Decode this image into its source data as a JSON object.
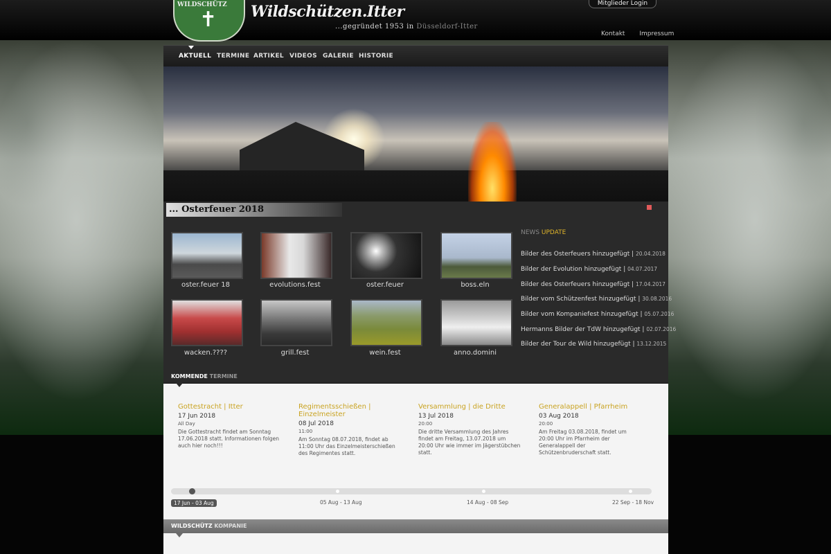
{
  "header": {
    "site_title": "Wildschützen.Itter",
    "subtitle_pre": "...gegründet 1953 in ",
    "subtitle_place": "Düsseldorf-Itter",
    "logo_text": "WILDSCHÜTZ",
    "login_label": "Mitglieder Login",
    "links": [
      "Kontakt",
      "Impressum"
    ]
  },
  "nav": {
    "items": [
      "AKTUELL",
      "TERMINE",
      "ARTIKEL",
      "VIDEOS",
      "GALERIE",
      "HISTORIE"
    ],
    "active": "AKTUELL"
  },
  "hero": {
    "caption": "... Osterfeuer 2018",
    "accent": "#e25a5a"
  },
  "gallery": {
    "items": [
      {
        "label": "oster.feuer 18"
      },
      {
        "label": "evolutions.fest"
      },
      {
        "label": "oster.feuer"
      },
      {
        "label": "boss.eln"
      },
      {
        "label": "wacken.????"
      },
      {
        "label": "grill.fest"
      },
      {
        "label": "wein.fest"
      },
      {
        "label": "anno.domini"
      }
    ]
  },
  "news": {
    "head_pre": "NEWS ",
    "head_hl": "UPDATE",
    "items": [
      {
        "text": "Bilder des Osterfeuers hinzugefügt",
        "date": "20.04.2018"
      },
      {
        "text": "Bilder der Evolution hinzugefügt",
        "date": "04.07.2017"
      },
      {
        "text": "Bilder des Osterfeuers hinzugefügt",
        "date": "17.04.2017"
      },
      {
        "text": "Bilder vom Schützenfest hinzugefügt",
        "date": "30.08.2016"
      },
      {
        "text": "Bilder vom Kompaniefest hinzugefügt",
        "date": "05.07.2016"
      },
      {
        "text": "Hermanns Bilder der TdW hinzugefügt",
        "date": "02.07.2016"
      },
      {
        "text": "Bilder der Tour de Wild hinzugefügt",
        "date": "13.12.2015"
      }
    ]
  },
  "events": {
    "head_pre": "KOMMENDE ",
    "head_dim": "TERMINE",
    "items": [
      {
        "title": "Gottestracht | Itter",
        "date": "17 Jun 2018",
        "time": "All Day",
        "desc": "Die Gottestracht findet am Sonntag 17.06.2018 statt. Informationen folgen auch hier noch!!!"
      },
      {
        "title": "Regimentsschießen | Einzelmeister",
        "date": "08 Jul 2018",
        "time": "11:00",
        "desc": "Am Sonntag 08.07.2018, findet ab 11:00 Uhr das Einzelmeisterschießen des Regimentes statt."
      },
      {
        "title": "Versammlung | die Dritte",
        "date": "13 Jul 2018",
        "time": "20:00",
        "desc": "Die dritte Versammlung des Jahres findet am Freitag, 13.07.2018 um 20:00 Uhr wie immer im Jägerstübchen statt."
      },
      {
        "title": "Generalappell | Pfarrheim",
        "date": "03 Aug 2018",
        "time": "20:00",
        "desc": "Am Freitag 03.08.2018, findet um 20:00 Uhr im Pfarrheim der Generalappell der Schützenbruderschaft statt."
      }
    ],
    "timeline": [
      "17 Jun - 03 Aug",
      "05 Aug - 13 Aug",
      "14 Aug - 08 Sep",
      "22 Sep - 18 Nov"
    ]
  },
  "company": {
    "head_pre": "WILDSCHÜTZ ",
    "head_dim": "KOMPANIE"
  }
}
